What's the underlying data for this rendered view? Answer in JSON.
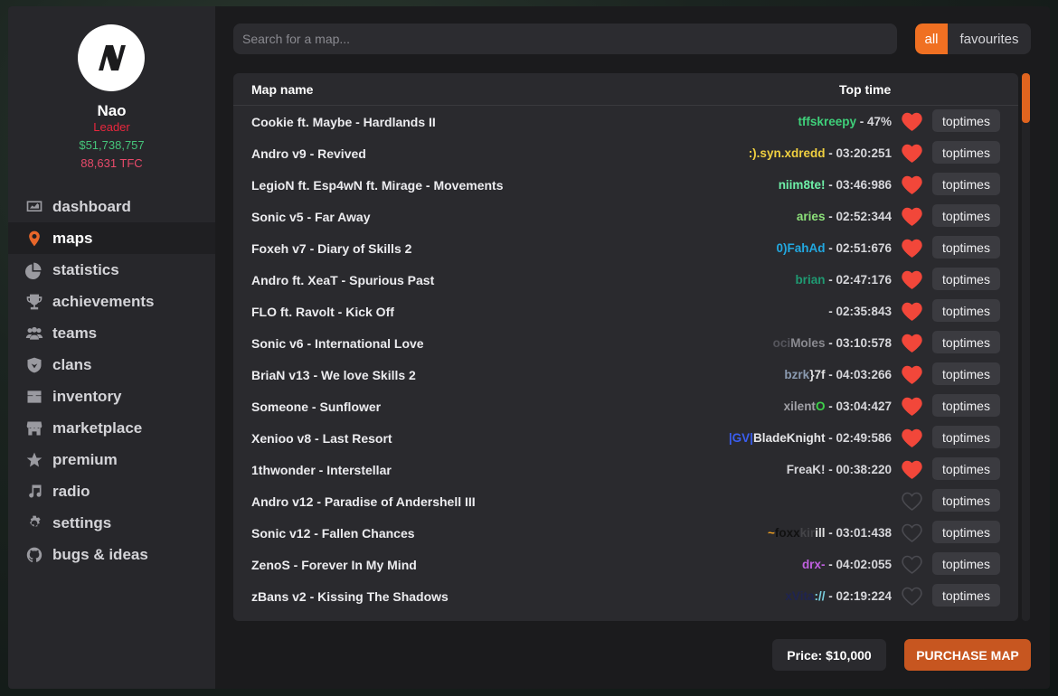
{
  "profile": {
    "name": "Nao",
    "role": "Leader",
    "money": "$51,738,757",
    "tfc": "88,631 TFC",
    "colors": {
      "role": "#e8273d",
      "money": "#45c47a",
      "tfc": "#e84a6a"
    }
  },
  "nav": [
    {
      "label": "dashboard",
      "icon": "dashboard-icon"
    },
    {
      "label": "maps",
      "icon": "map-pin-icon",
      "active": true
    },
    {
      "label": "statistics",
      "icon": "pie-chart-icon"
    },
    {
      "label": "achievements",
      "icon": "trophy-icon"
    },
    {
      "label": "teams",
      "icon": "users-icon"
    },
    {
      "label": "clans",
      "icon": "shield-icon"
    },
    {
      "label": "inventory",
      "icon": "chest-icon"
    },
    {
      "label": "marketplace",
      "icon": "store-icon"
    },
    {
      "label": "premium",
      "icon": "star-icon"
    },
    {
      "label": "radio",
      "icon": "music-note-icon"
    },
    {
      "label": "settings",
      "icon": "gear-icon"
    },
    {
      "label": "bugs & ideas",
      "icon": "github-icon"
    }
  ],
  "search": {
    "placeholder": "Search for a map..."
  },
  "filters": {
    "all": "all",
    "favourites": "favourites",
    "active": "all"
  },
  "table": {
    "headers": {
      "name": "Map name",
      "time": "Top time"
    },
    "toptimes_label": "toptimes",
    "rows": [
      {
        "name": "Cookie ft. Maybe - Hardlands II",
        "player": [
          {
            "t": "tffskreepy",
            "c": "#3fd07a"
          }
        ],
        "time": " - 47%",
        "fav": true
      },
      {
        "name": "Andro v9 - Revived",
        "player": [
          {
            "t": ":).syn.xdredd",
            "c": "#f0d040"
          }
        ],
        "time": " - 03:20:251",
        "fav": true
      },
      {
        "name": "LegioN ft. Esp4wN ft. Mirage - Movements",
        "player": [
          {
            "t": "niim8te!",
            "c": "#6ef0a8"
          }
        ],
        "time": " - 03:46:986",
        "fav": true
      },
      {
        "name": "Sonic v5 - Far Away",
        "player": [
          {
            "t": "aries",
            "c": "#8ce07a"
          }
        ],
        "time": " - 02:52:344",
        "fav": true
      },
      {
        "name": "Foxeh v7 - Diary of Skills 2",
        "player": [
          {
            "t": "0)FahAd",
            "c": "#22a8e0"
          }
        ],
        "time": " - 02:51:676",
        "fav": true
      },
      {
        "name": "Andro ft. XeaT - Spurious Past",
        "player": [
          {
            "t": "brian",
            "c": "#1f9a72"
          }
        ],
        "time": " - 02:47:176",
        "fav": true
      },
      {
        "name": "FLO ft. Ravolt - Kick Off",
        "player": [],
        "time": " - 02:35:843",
        "fav": true
      },
      {
        "name": "Sonic v6 - International Love",
        "player": [
          {
            "t": "oci",
            "c": "#55555c"
          },
          {
            "t": "Moles",
            "c": "#8a8a90"
          }
        ],
        "time": " - 03:10:578",
        "fav": true
      },
      {
        "name": "BriaN v13 - We love Skills 2",
        "player": [
          {
            "t": "bzrk",
            "c": "#8a9ab0"
          },
          {
            "t": "}7f",
            "c": "#e0e0e0"
          }
        ],
        "time": " - 04:03:266",
        "fav": true
      },
      {
        "name": "Someone - Sunflower",
        "player": [
          {
            "t": "xilent",
            "c": "#a0a0a6"
          },
          {
            "t": "O",
            "c": "#3ed04a"
          }
        ],
        "time": " - 03:04:427",
        "fav": true
      },
      {
        "name": "Xenioo v8 - Last Resort",
        "player": [
          {
            "t": "|GV|",
            "c": "#3a5ef0"
          },
          {
            "t": "BladeKnight",
            "c": "#e6e6e8"
          }
        ],
        "time": " - 02:49:586",
        "fav": true
      },
      {
        "name": "1thwonder - Interstellar",
        "player": [
          {
            "t": "FreaK!",
            "c": "#d6d6da"
          }
        ],
        "time": " - 00:38:220",
        "fav": true
      },
      {
        "name": "Andro v12 - Paradise of Andershell III",
        "player": [],
        "time": "",
        "fav": false
      },
      {
        "name": "Sonic v12 - Fallen Chances",
        "player": [
          {
            "t": "~",
            "c": "#f0a020"
          },
          {
            "t": "foxx",
            "c": "#111111"
          },
          {
            "t": "kir",
            "c": "#444448"
          },
          {
            "t": "ill",
            "c": "#e0e0e0"
          }
        ],
        "time": " - 03:01:438",
        "fav": false
      },
      {
        "name": "ZenoS - Forever In My Mind",
        "player": [
          {
            "t": "drx-",
            "c": "#c060e0"
          }
        ],
        "time": " - 04:02:055",
        "fav": false
      },
      {
        "name": "zBans v2 - Kissing The Shadows",
        "player": [
          {
            "t": "xVita",
            "c": "#1f2450"
          },
          {
            "t": "://",
            "c": "#7ad0e0"
          }
        ],
        "time": " - 02:19:224",
        "fav": false
      }
    ]
  },
  "footer": {
    "price": "Price: $10,000",
    "purchase": "PURCHASE MAP"
  },
  "colors": {
    "accent": "#f07022",
    "heart_on": "#f2473a",
    "heart_off": "#4a4a50"
  }
}
